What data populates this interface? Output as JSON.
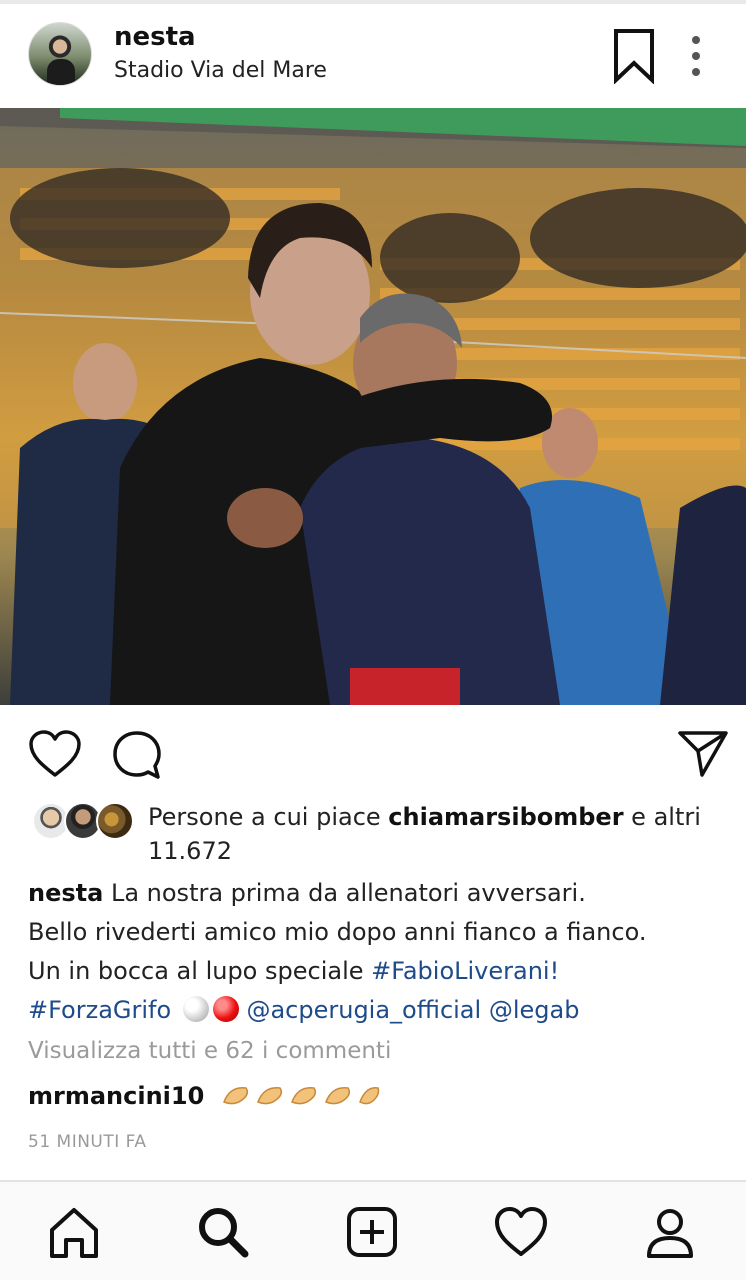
{
  "post": {
    "username": "nesta",
    "location": "Stadio Via del Mare"
  },
  "likes": {
    "prefix": "Persone a cui piace ",
    "top_liker": "chiamarsibomber",
    "suffix": " e altri",
    "count": "11.672"
  },
  "caption": {
    "username": "nesta",
    "line1": " La nostra prima da allenatori avversari.",
    "line2": "Bello rivederti amico mio dopo anni fianco a fianco.",
    "line3_text": "Un in bocca al lupo speciale ",
    "hashtag1": "#FabioLiverani!",
    "hashtag2": "#ForzaGrifo",
    "mention1": "@acperugia_official",
    "mention2": "@legab"
  },
  "view_all_comments": "Visualizza tutti e 62 i commenti",
  "comment": {
    "username": "mrmancini10"
  },
  "timestamp": "51 MINUTI FA",
  "icons": {
    "bookmark": "bookmark-icon",
    "more": "more-vertical-icon",
    "like": "heart-icon",
    "comment": "comment-icon",
    "share": "send-icon",
    "nav_home": "home-icon",
    "nav_search": "search-icon",
    "nav_add": "add-post-icon",
    "nav_activity": "heart-icon",
    "nav_profile": "profile-icon"
  },
  "colors": {
    "hashtag": "#1e4b8a",
    "muted": "#9a9a9a"
  }
}
